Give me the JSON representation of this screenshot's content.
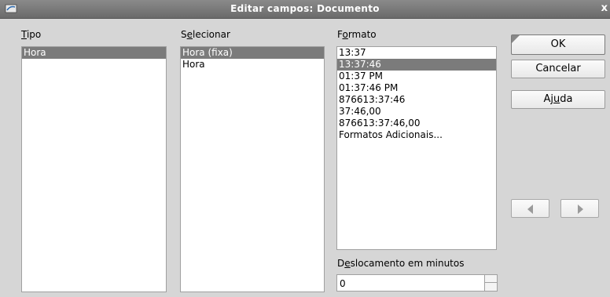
{
  "window": {
    "title": "Editar campos: Documento",
    "close_glyph": "x"
  },
  "tipo": {
    "label_pre": "",
    "label_ul": "T",
    "label_post": "ipo",
    "items": [
      "Hora"
    ],
    "selected_index": 0
  },
  "selecionar": {
    "label_pre": "S",
    "label_ul": "e",
    "label_post": "lecionar",
    "items": [
      "Hora (fixa)",
      "Hora"
    ],
    "selected_index": 0
  },
  "formato": {
    "label_pre": "F",
    "label_ul": "o",
    "label_post": "rmato",
    "items": [
      "13:37",
      "13:37:46",
      "01:37 PM",
      "01:37:46 PM",
      "876613:37:46",
      "37:46,00",
      "876613:37:46,00",
      "Formatos Adicionais..."
    ],
    "selected_index": 1
  },
  "offset": {
    "label_pre": "D",
    "label_ul": "e",
    "label_post": "slocamento em minutos",
    "value": "0"
  },
  "buttons": {
    "ok": "OK",
    "cancel": "Cancelar",
    "help_pre": "Aj",
    "help_ul": "u",
    "help_post": "da"
  },
  "colors": {
    "title_bar": "#6e6e6e",
    "selection": "#7b7b7b",
    "dialog_bg": "#d6d6d6"
  }
}
